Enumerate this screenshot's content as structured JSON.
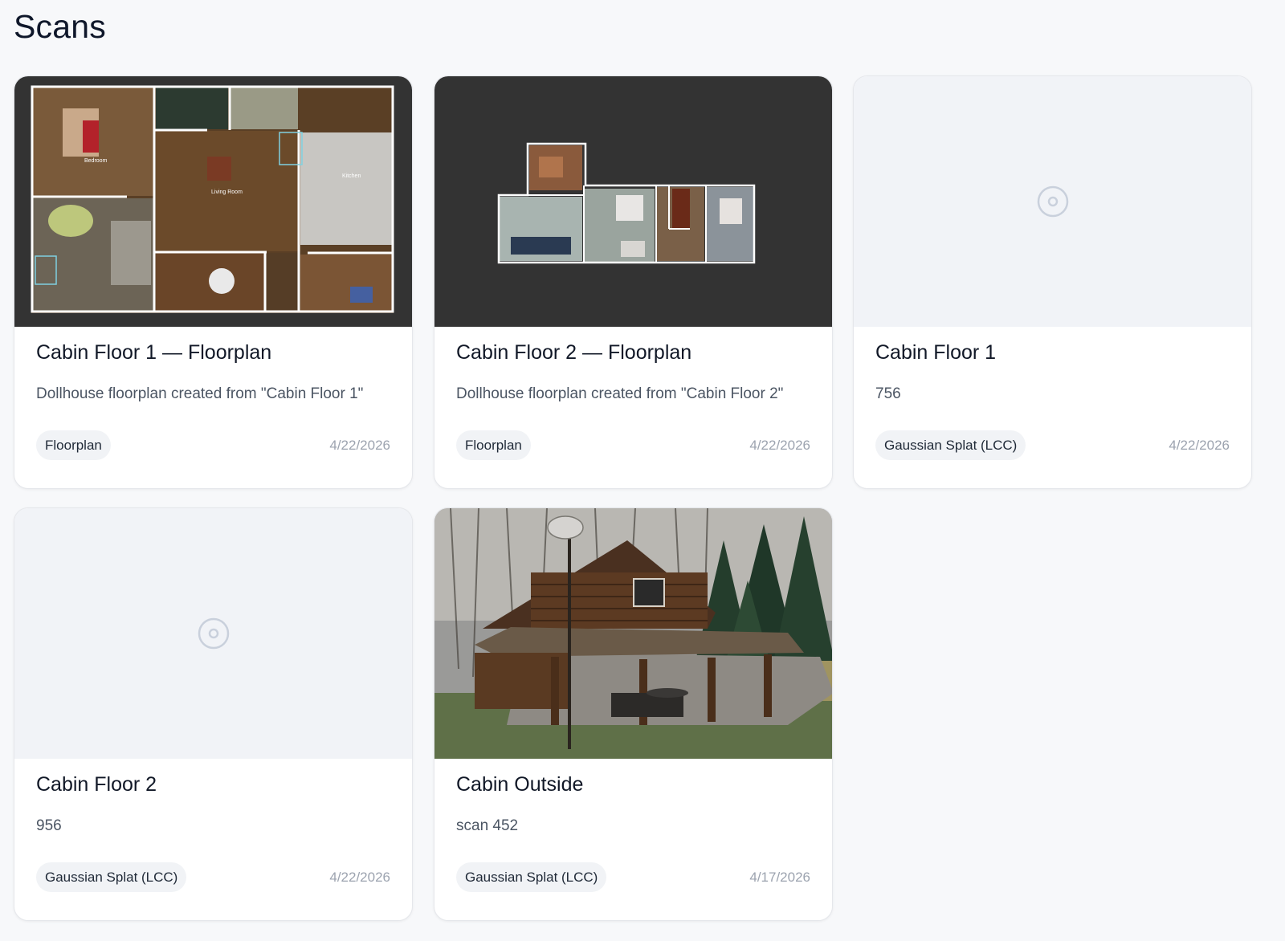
{
  "page": {
    "title": "Scans"
  },
  "cards": [
    {
      "title": "Cabin Floor 1 — Floorplan",
      "description": "Dollhouse floorplan created from \"Cabin Floor 1\"",
      "type": "Floorplan",
      "date": "4/22/2026",
      "thumbnail": "floorplan-image",
      "room_labels": [
        "Bedroom",
        "Living Room",
        "Kitchen"
      ]
    },
    {
      "title": "Cabin Floor 2 — Floorplan",
      "description": "Dollhouse floorplan created from \"Cabin Floor 2\"",
      "type": "Floorplan",
      "date": "4/22/2026",
      "thumbnail": "floorplan-image"
    },
    {
      "title": "Cabin Floor 1",
      "description": "756",
      "type": "Gaussian Splat (LCC)",
      "date": "4/22/2026",
      "thumbnail": "scan-placeholder-icon"
    },
    {
      "title": "Cabin Floor 2",
      "description": "956",
      "type": "Gaussian Splat (LCC)",
      "date": "4/22/2026",
      "thumbnail": "scan-placeholder-icon"
    },
    {
      "title": "Cabin Outside",
      "description": "scan 452",
      "type": "Gaussian Splat (LCC)",
      "date": "4/17/2026",
      "thumbnail": "cabin-photo"
    }
  ],
  "colors": {
    "background": "#f7f8fa",
    "card": "#ffffff",
    "thumb_dark": "#333333",
    "thumb_empty": "#f1f3f7",
    "badge": "#f1f3f6",
    "date": "#9ca3af"
  }
}
